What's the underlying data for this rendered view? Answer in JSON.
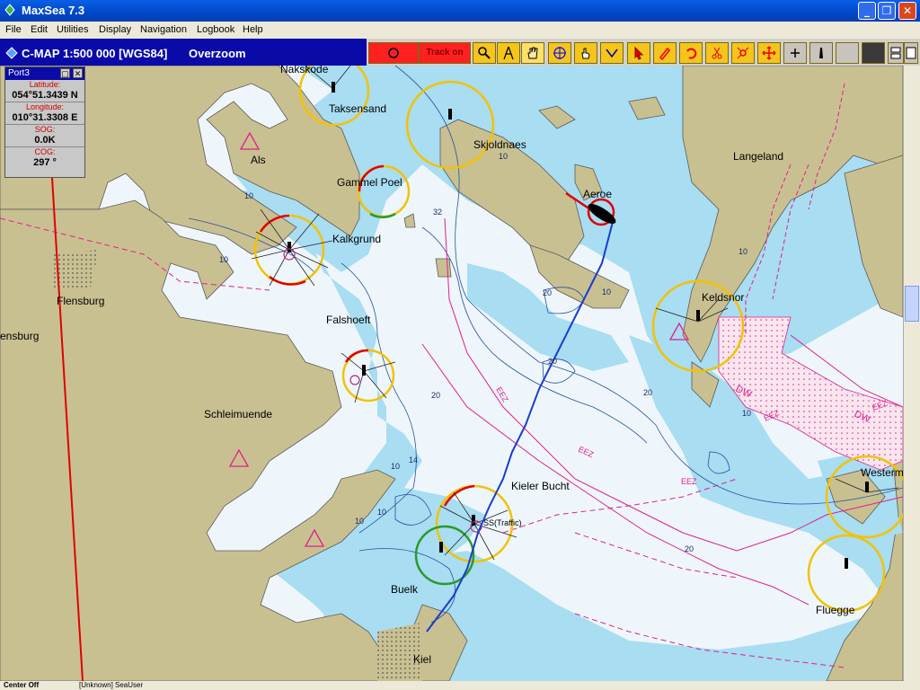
{
  "window": {
    "title": "MaxSea 7.3",
    "minimize": "_",
    "restore": "❐",
    "close": "✕"
  },
  "menu": [
    "File",
    "Edit",
    "Utilities",
    "Display",
    "Navigation",
    "Logbook",
    "Help"
  ],
  "chartbar": {
    "title": "C-MAP  1:500 000 [WGS84]",
    "mode": "Overzoom"
  },
  "toolbar": {
    "track_label": "Track on"
  },
  "panel": {
    "title": "Port3",
    "latitude_label": "Latitude:",
    "latitude": "054°51.3439 N",
    "longitude_label": "Longitude:",
    "longitude": "010°31.3308 E",
    "sog_label": "SOG:",
    "sog": "0.0K",
    "cog_label": "COG:",
    "cog": "297 °"
  },
  "map": {
    "places": [
      "Nakskode",
      "Taksensand",
      "Als",
      "Skjoldnaes",
      "Langeland",
      "Aeroe",
      "Gammel Poel",
      "Kalkgrund",
      "Flensburg",
      "ensburg",
      "Falshoeft",
      "Keldsnor",
      "Schleimuende",
      "Kieler Bucht",
      "Westerm",
      "Buelk",
      "Fluegge",
      "Kiel"
    ],
    "depths": [
      "32",
      "14",
      "20",
      "10",
      "20",
      "10",
      "20",
      "10",
      "10",
      "10",
      "10",
      "20",
      "10",
      "10",
      "10",
      "20"
    ],
    "zones": [
      "EEZ",
      "EEZ",
      "EEZ",
      "EEZ",
      "EEZ",
      "DW",
      "DW"
    ],
    "traffic_label": "SS(Traffic)"
  },
  "status": {
    "left": "Center Off",
    "user": "[Unknown] SeaUser"
  },
  "colors": {
    "land": "#c9c091",
    "shallow": "#a8ddf2",
    "deep": "#eef6fc",
    "track": "#1a3cd0",
    "zone": "#e0208a"
  }
}
